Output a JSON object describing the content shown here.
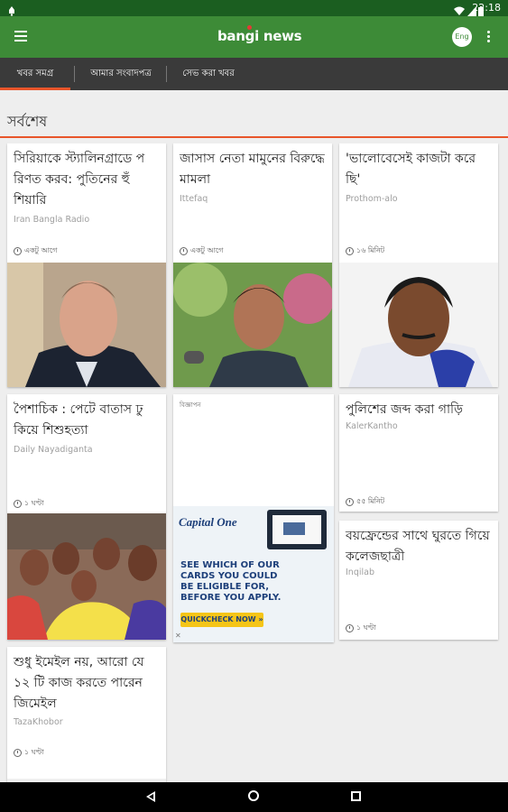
{
  "status": {
    "time": "22:18"
  },
  "app": {
    "logo": "bangi news",
    "lang_button": "Eng"
  },
  "tabs": [
    {
      "label": "খবর সমগ্র"
    },
    {
      "label": "আমার সংবাদপত্র"
    },
    {
      "label": "সেভ করা খবর"
    }
  ],
  "section": {
    "title": "সর্বশেষ"
  },
  "cards": [
    {
      "title": "সিরিয়াকে স্ট্যালিনগ্রাডে প রিণত করব: পুতিনের হুঁ শিয়ারি",
      "source": "Iran Bangla Radio",
      "time": "একটু আগে"
    },
    {
      "title": "জাসাস নেতা মামুনের বিরুদ্ধে মামলা",
      "source": "Ittefaq",
      "time": "একটু আগে"
    },
    {
      "title": "'ভালোবেসেই কাজটা করে ছি'",
      "source": "Prothom-alo",
      "time": "১৬ মিনিট"
    },
    {
      "title": "পৈশাচিক : পেটে বাতাস ঢু কিয়ে শিশুহত্যা",
      "source": "Daily Nayadiganta",
      "time": "১ ঘণ্টা"
    },
    {
      "ad_label": "বিজ্ঞাপন",
      "ad_brand": "Capital One",
      "ad_text": "SEE WHICH OF OUR CARDS YOU COULD BE ELIGIBLE FOR, BEFORE YOU APPLY.",
      "ad_cta": "QUICKCHECK NOW »"
    },
    {
      "title": "পুলিশের জব্দ করা গাড়ি",
      "source": "KalerKantho",
      "time": "৫৫ মিনিট"
    },
    {
      "title": "বয়ফ্রেন্ডের সাথে ঘুরতে গিয়ে কলেজছাত্রী",
      "source": "Inqilab",
      "time": "১ ঘণ্টা"
    },
    {
      "title": "শুধু ইমেইল নয়, আরো যে ১২ টি কাজ করতে পারেন জিমেইল",
      "source": "TazaKhobor",
      "time": "১ ঘণ্টা"
    }
  ],
  "colors": {
    "appbar": "#3d8b37",
    "statusbar": "#1b5e20",
    "tabbar": "#3a3a3a",
    "accent": "#e8552a"
  }
}
